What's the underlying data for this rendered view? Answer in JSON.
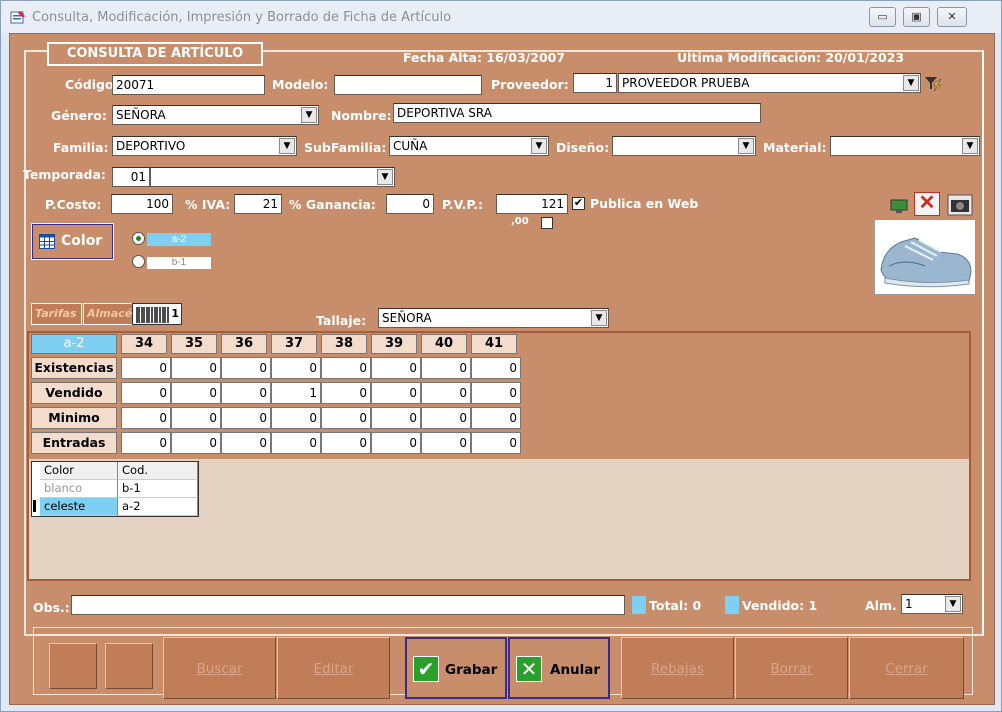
{
  "window": {
    "title": "Consulta, Modificación, Impresión y Borrado de Ficha de Artículo",
    "minimize": "▭",
    "maximize": "▣",
    "close": "✕"
  },
  "header": {
    "section": "CONSULTA DE ARTÍCULO",
    "fecha_alta": "Fecha Alta: 16/03/2007",
    "ultima_mod": "Última Modificación: 20/01/2023"
  },
  "fields": {
    "codigo_label": "Código:",
    "codigo": "20071",
    "modelo_label": "Modelo:",
    "modelo": "",
    "proveedor_label": "Proveedor:",
    "proveedor_num": "1",
    "proveedor": "PROVEEDOR PRUEBA",
    "genero_label": "Género:",
    "genero": "SEÑORA",
    "nombre_label": "Nombre:",
    "nombre": "DEPORTIVA SRA",
    "familia_label": "Familia:",
    "familia": "DEPORTIVO",
    "subfamilia_label": "SubFamilia:",
    "subfamilia": "CUÑA",
    "diseno_label": "Diseño:",
    "diseno": "",
    "material_label": "Material:",
    "material": "",
    "temporada_label": "Temporada:",
    "temporada_code": "01",
    "temporada": "",
    "pcosto_label": "P.Costo:",
    "pcosto": "100",
    "iva_label": "% IVA:",
    "iva": "21",
    "ganancia_label": "% Ganancia:",
    "ganancia": "0",
    "pvp_label": "P.V.P.:",
    "pvp": "121",
    "publica_label": "Publica en Web",
    "cents_label": ",00"
  },
  "color": {
    "button": "Color",
    "options": [
      "a-2",
      "b-1"
    ],
    "selected": "a-2"
  },
  "tabs": {
    "tarifas": "Tarifas",
    "almacen": "Almacén",
    "barcode": "1"
  },
  "tallaje": {
    "label": "Tallaje:",
    "value": "SEÑORA"
  },
  "grid": {
    "corner": "a-2",
    "sizes": [
      "34",
      "35",
      "36",
      "37",
      "38",
      "39",
      "40",
      "41"
    ],
    "rows": [
      {
        "label": "Existencias",
        "values": [
          "0",
          "0",
          "0",
          "0",
          "0",
          "0",
          "0",
          "0"
        ]
      },
      {
        "label": "Vendido",
        "values": [
          "0",
          "0",
          "0",
          "1",
          "0",
          "0",
          "0",
          "0"
        ]
      },
      {
        "label": "Minimo",
        "values": [
          "0",
          "0",
          "0",
          "0",
          "0",
          "0",
          "0",
          "0"
        ]
      },
      {
        "label": "Entradas",
        "values": [
          "0",
          "0",
          "0",
          "0",
          "0",
          "0",
          "0",
          "0"
        ]
      }
    ]
  },
  "color_table": {
    "headers": [
      "Color",
      "Cod."
    ],
    "rows": [
      [
        "blanco",
        "b-1"
      ],
      [
        "celeste",
        "a-2"
      ]
    ]
  },
  "footer": {
    "obs_label": "Obs.:",
    "obs": "",
    "total": "Total: 0",
    "vendido": "Vendido: 1",
    "alm_label": "Alm.",
    "alm": "1"
  },
  "buttons": {
    "buscar": "Buscar",
    "editar": "Editar",
    "grabar": "Grabar",
    "anular": "Anular",
    "rebajas": "Rebajas",
    "borrar": "Borrar",
    "cerrar": "Cerrar"
  }
}
